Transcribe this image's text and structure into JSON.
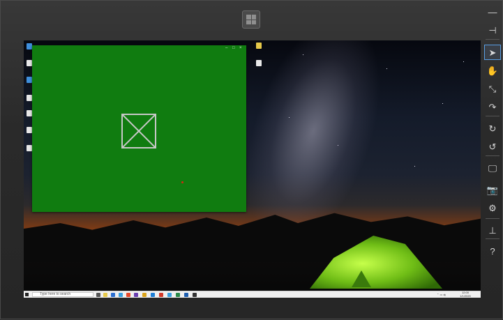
{
  "remote": {
    "windows_button_icon": "windows-tiles-icon"
  },
  "app_window": {
    "title": "",
    "controls": {
      "minimize": "–",
      "maximize": "□",
      "close": "×"
    },
    "background": "#107c10",
    "content_icon": "image-placeholder-icon"
  },
  "taskbar": {
    "search_placeholder": "Type here to search",
    "clock_time": "12:00",
    "clock_date": "1/1/2020"
  },
  "toolbar": {
    "buttons": [
      {
        "icon": "minimize-icon",
        "glyph": "—"
      },
      {
        "icon": "pin-icon",
        "glyph": "⊣"
      },
      {
        "icon": "pointer-icon",
        "glyph": "➤",
        "active": true
      },
      {
        "icon": "hand-icon",
        "glyph": "✋"
      },
      {
        "icon": "pinch-icon",
        "glyph": "⤡"
      },
      {
        "icon": "rotate-gesture-icon",
        "glyph": "↷"
      },
      {
        "icon": "rotate-clockwise-icon",
        "glyph": "↻"
      },
      {
        "icon": "rotate-counterclockwise-icon",
        "glyph": "↺"
      },
      {
        "icon": "monitor-icon",
        "glyph": "🖵"
      },
      {
        "icon": "camera-icon",
        "glyph": "📷"
      },
      {
        "icon": "settings-gear-icon",
        "glyph": "⚙"
      },
      {
        "icon": "network-icon",
        "glyph": "⊥"
      },
      {
        "icon": "help-icon",
        "glyph": "?"
      }
    ]
  }
}
